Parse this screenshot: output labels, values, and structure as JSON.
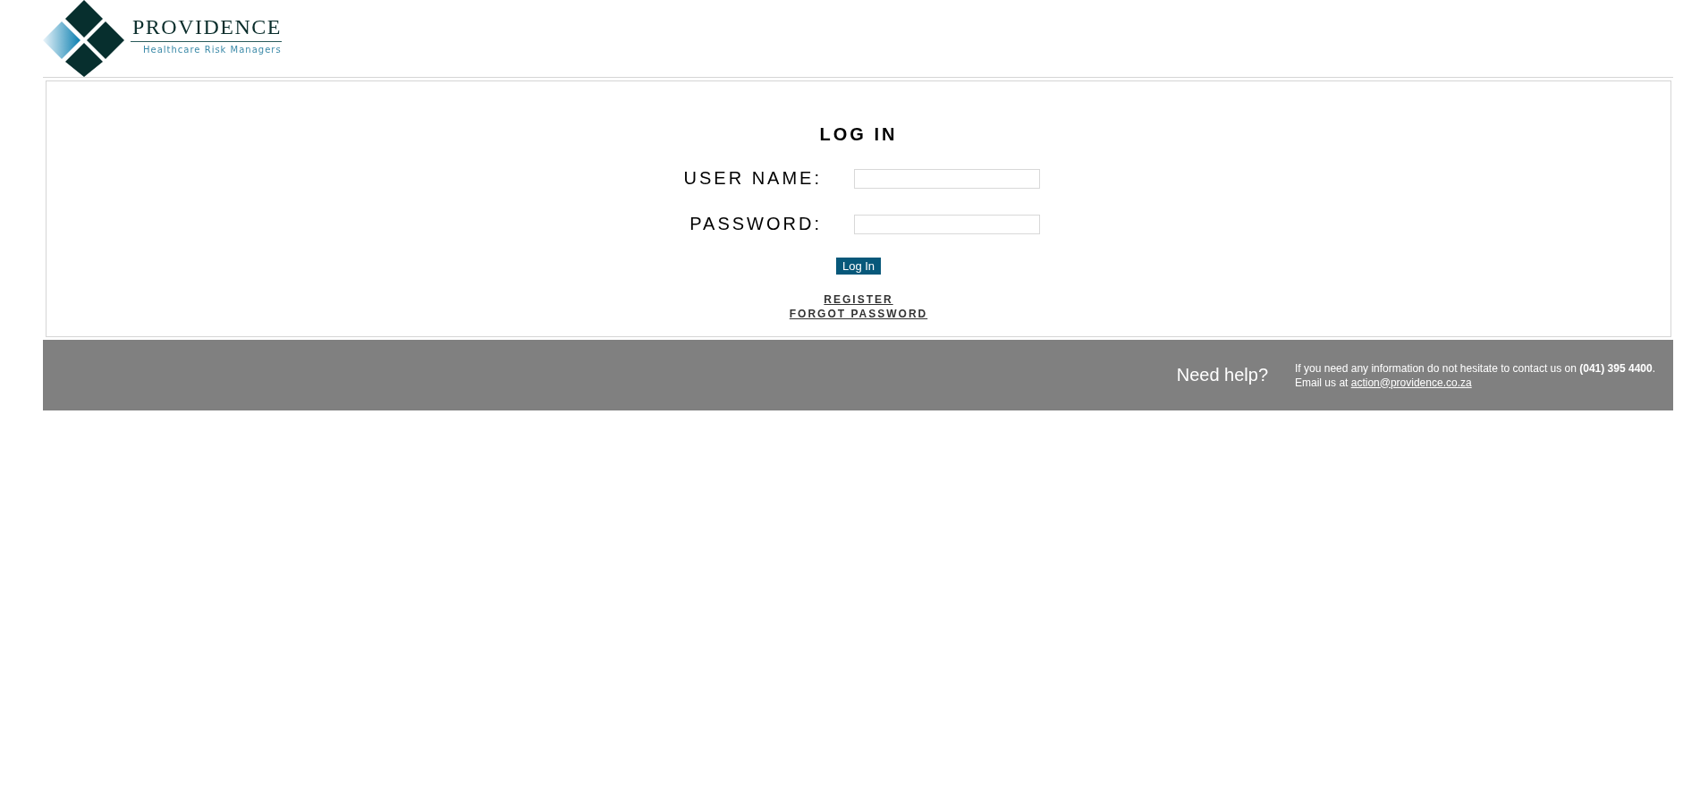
{
  "logo": {
    "name": "PROVIDENCE",
    "tagline": "Healthcare Risk Managers"
  },
  "login": {
    "title": "LOG IN",
    "fields": [
      {
        "label": "USER NAME:"
      },
      {
        "label": "PASSWORD:"
      }
    ],
    "button": "Log In",
    "links": [
      "REGISTER",
      "FORGOT PASSWORD"
    ]
  },
  "footer": {
    "heading": "Need help?",
    "message": "If you need any information do not hesitate to contact us on **(041) 395 4400**.",
    "email_prefix": "Email us at",
    "email": "action@providence.co.za"
  }
}
